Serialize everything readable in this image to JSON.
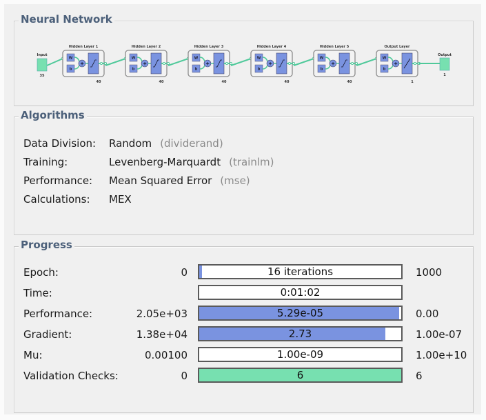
{
  "neural_network": {
    "title": "Neural Network",
    "input": {
      "label": "Input",
      "size": "35"
    },
    "layers": [
      {
        "label": "Hidden Layer 1",
        "size": "40",
        "weight": "W",
        "bias": "b",
        "transfer": "sigmoid"
      },
      {
        "label": "Hidden Layer 2",
        "size": "40",
        "weight": "W",
        "bias": "b",
        "transfer": "sigmoid"
      },
      {
        "label": "Hidden Layer 3",
        "size": "40",
        "weight": "W",
        "bias": "b",
        "transfer": "sigmoid"
      },
      {
        "label": "Hidden Layer 4",
        "size": "40",
        "weight": "W",
        "bias": "b",
        "transfer": "sigmoid"
      },
      {
        "label": "Hidden Layer 5",
        "size": "40",
        "weight": "W",
        "bias": "b",
        "transfer": "sigmoid"
      },
      {
        "label": "Output Layer",
        "size": "1",
        "weight": "W",
        "bias": "b",
        "transfer": "linear"
      }
    ],
    "output": {
      "label": "Output",
      "size": "1"
    },
    "colors": {
      "io_block": "#77e0b0",
      "layer_block": "#7a93e0",
      "connection": "#4fc99a"
    }
  },
  "algorithms": {
    "title": "Algorithms",
    "rows": [
      {
        "label": "Data Division:",
        "value": "Random",
        "func": "(dividerand)"
      },
      {
        "label": "Training:",
        "value": "Levenberg-Marquardt",
        "func": "(trainlm)"
      },
      {
        "label": "Performance:",
        "value": "Mean Squared Error",
        "func": "(mse)"
      },
      {
        "label": "Calculations:",
        "value": "MEX",
        "func": ""
      }
    ]
  },
  "progress": {
    "title": "Progress",
    "rows": [
      {
        "label": "Epoch:",
        "start": "0",
        "current": "16 iterations",
        "end": "1000",
        "fill": 0.016,
        "color": "#7a93e0"
      },
      {
        "label": "Time:",
        "start": "",
        "current": "0:01:02",
        "end": "",
        "fill": 0,
        "color": "#7a93e0"
      },
      {
        "label": "Performance:",
        "start": "2.05e+03",
        "current": "5.29e-05",
        "end": "0.00",
        "fill": 0.99,
        "color": "#7a93e0"
      },
      {
        "label": "Gradient:",
        "start": "1.38e+04",
        "current": "2.73",
        "end": "1.00e-07",
        "fill": 0.92,
        "color": "#7a93e0"
      },
      {
        "label": "Mu:",
        "start": "0.00100",
        "current": "1.00e-09",
        "end": "1.00e+10",
        "fill": 0,
        "color": "#7a93e0"
      },
      {
        "label": "Validation Checks:",
        "start": "0",
        "current": "6",
        "end": "6",
        "fill": 1.0,
        "color": "#77e0b0"
      }
    ]
  }
}
